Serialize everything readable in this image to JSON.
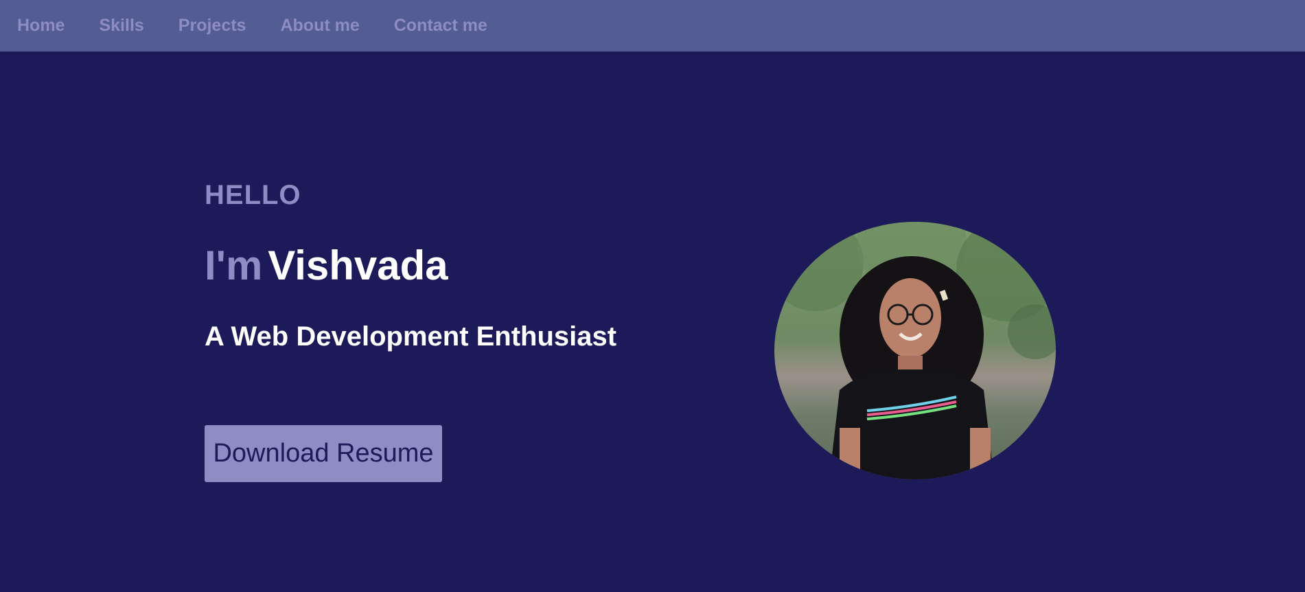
{
  "nav": {
    "items": [
      {
        "label": "Home"
      },
      {
        "label": "Skills"
      },
      {
        "label": "Projects"
      },
      {
        "label": "About me"
      },
      {
        "label": "Contact me"
      }
    ]
  },
  "hero": {
    "greeting": "HELLO",
    "prefix": "I'm",
    "name": "Vishvada",
    "tagline": "A Web Development Enthusiast",
    "button_label": "Download Resume",
    "photo_icon": "profile-photo"
  },
  "colors": {
    "background": "#1c1a58",
    "navbar": "#535d93",
    "accent": "#8d8cc4",
    "text": "#ffffff"
  }
}
